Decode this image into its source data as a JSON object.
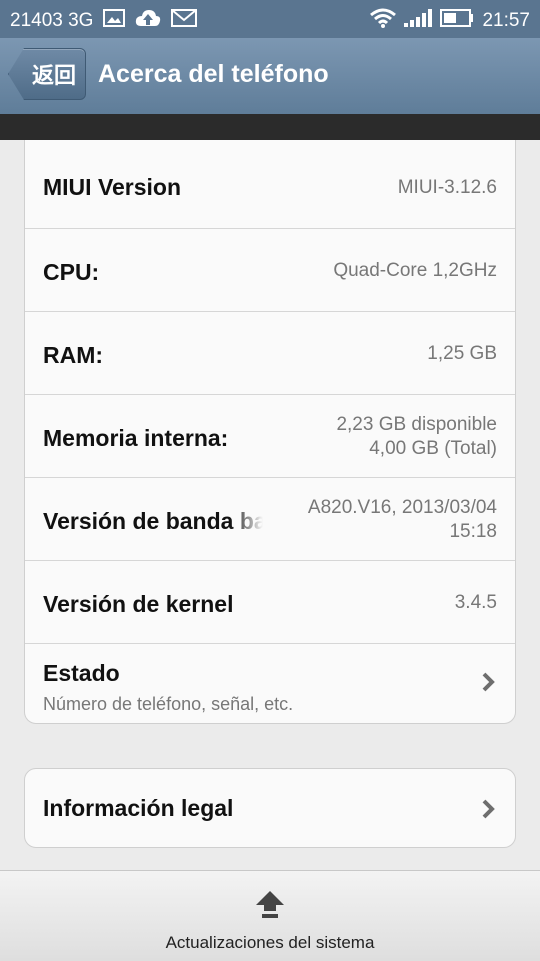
{
  "status_bar": {
    "carrier": "21403 3G",
    "icons": [
      "image-icon",
      "cloud-upload-icon",
      "mail-icon",
      "wifi-icon",
      "signal-icon",
      "battery-icon"
    ],
    "time": "21:57"
  },
  "header": {
    "back_label": "返回",
    "title": "Acerca del teléfono"
  },
  "info_rows": [
    {
      "label": "MIUI Version",
      "value": "MIUI-3.12.6"
    },
    {
      "label": "CPU:",
      "value": "Quad-Core 1,2GHz"
    },
    {
      "label": "RAM:",
      "value": "1,25 GB"
    },
    {
      "label": "Memoria interna:",
      "value_line1": "2,23 GB disponible",
      "value_line2": "4,00 GB (Total)"
    },
    {
      "label": "Versión de banda ba",
      "value_line1": "A820.V16, 2013/03/04",
      "value_line2": "15:18"
    },
    {
      "label": "Versión de kernel",
      "value": "3.4.5"
    },
    {
      "label": "Estado",
      "sub": "Número de teléfono, señal, etc."
    }
  ],
  "legal": {
    "label": "Información legal"
  },
  "bottom_bar": {
    "label": "Actualizaciones del sistema"
  },
  "colors": {
    "status_bar": "#5a7590",
    "title_bar": "#6b88a4",
    "card_bg": "#fafafa",
    "page_bg": "#ebebeb"
  }
}
